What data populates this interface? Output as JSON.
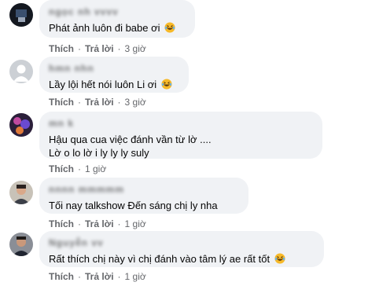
{
  "comments": [
    {
      "name": "ngọc nh vvvv",
      "text_lines": [
        "Phát ảnh luôn đi babe ơi"
      ],
      "emoji": "laughing-emoji",
      "like_label": "Thích",
      "reply_label": "Trả lời",
      "time": "3 giờ"
    },
    {
      "name": "hmn nhn",
      "text_lines": [
        "Lầy lội hết nói luôn Li ơi"
      ],
      "emoji": "laughing-emoji",
      "like_label": "Thích",
      "reply_label": "Trả lời",
      "time": "3 giờ"
    },
    {
      "name": "mn k",
      "text_lines": [
        "Hậu qua cua việc đánh vần từ lờ ....",
        "Lờ o lo lờ i ly ly ly suly"
      ],
      "emoji": "",
      "like_label": "Thích",
      "reply_label": "",
      "time": "1 giờ"
    },
    {
      "name": "nnnn mmmmm",
      "text_lines": [
        "Tối nay talkshow Đến sáng chị ly nha"
      ],
      "emoji": "",
      "like_label": "Thích",
      "reply_label": "Trả lời",
      "time": "1 giờ"
    },
    {
      "name": "Nguyễn vv",
      "text_lines": [
        "Rất thích chị này vì chị đánh vào tâm lý ae rất tốt"
      ],
      "emoji": "laughing-emoji",
      "like_label": "Thích",
      "reply_label": "Trả lời",
      "time": "1 giờ"
    }
  ],
  "colors": {
    "bubble": "#f0f2f5",
    "meta_text": "#65676b",
    "text": "#050505"
  }
}
